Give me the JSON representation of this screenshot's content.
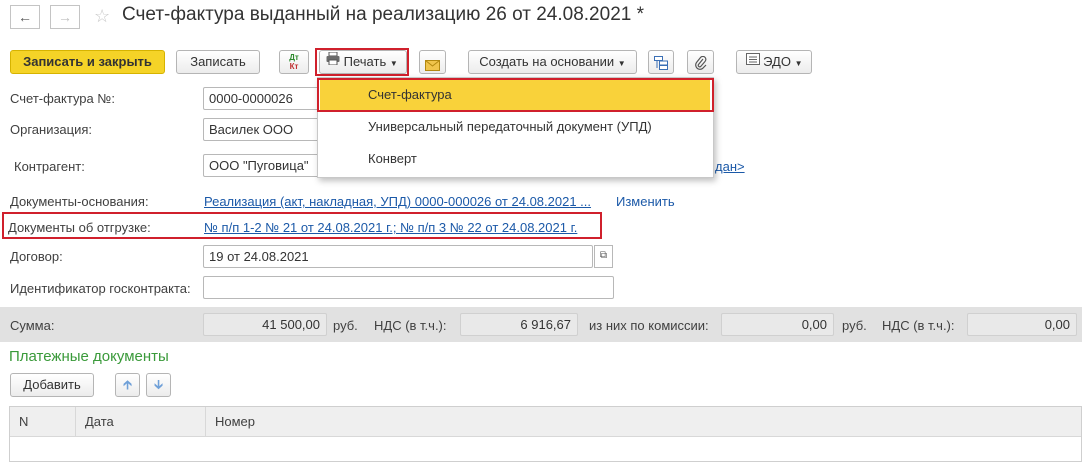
{
  "window": {
    "title": "Счет-фактура выданный на реализацию 26 от 24.08.2021 *"
  },
  "toolbar": {
    "save_close_label": "Записать и закрыть",
    "save_label": "Записать",
    "dt_kt_top": "Дт",
    "dt_kt_bottom": "Кт",
    "print_label": "Печать",
    "create_based_label": "Создать на основании",
    "edo_label": "ЭДО"
  },
  "print_menu": {
    "items": [
      {
        "label": "Счет-фактура"
      },
      {
        "label": "Универсальный передаточный документ (УПД)"
      },
      {
        "label": "Конверт"
      }
    ]
  },
  "form": {
    "invoice_number_label": "Счет-фактура №:",
    "invoice_number_value": "0000-0000026",
    "organization_label": "Организация:",
    "organization_value": "Василек ООО",
    "counterparty_label": "Контрагент:",
    "counterparty_value": "ООО \"Пуговица\"",
    "counterparty_link_tail": "дан>",
    "base_docs_label": "Документы-основания:",
    "base_docs_value": "Реализация (акт, накладная, УПД) 0000-000026 от 24.08.2021 ...",
    "change_link": "Изменить",
    "shipment_docs_label": "Документы об отгрузке:",
    "shipment_docs_value": "№ п/п 1-2 № 21 от 24.08.2021 г.; № п/п 3 № 22 от 24.08.2021 г.",
    "contract_label": "Договор:",
    "contract_value": "19 от 24.08.2021",
    "gov_contract_label": "Идентификатор госконтракта:",
    "gov_contract_value": ""
  },
  "sums": {
    "sum_label": "Сумма:",
    "sum_value": "41 500,00",
    "currency1": "руб.",
    "vat_label1": "НДС (в т.ч.):",
    "vat_value1": "6 916,67",
    "commission_label": "из них по комиссии:",
    "commission_value": "0,00",
    "currency2": "руб.",
    "vat_label2": "НДС (в т.ч.):",
    "vat_value2": "0,00"
  },
  "payments": {
    "section_title": "Платежные документы",
    "add_label": "Добавить",
    "columns": [
      "N",
      "Дата",
      "Номер"
    ]
  },
  "colors": {
    "primary_button": "#f5d327",
    "highlight_red": "#d0202c",
    "menu_selected": "#f9d23a",
    "section_green": "#3a9a3a",
    "link_blue": "#1b59a8"
  }
}
